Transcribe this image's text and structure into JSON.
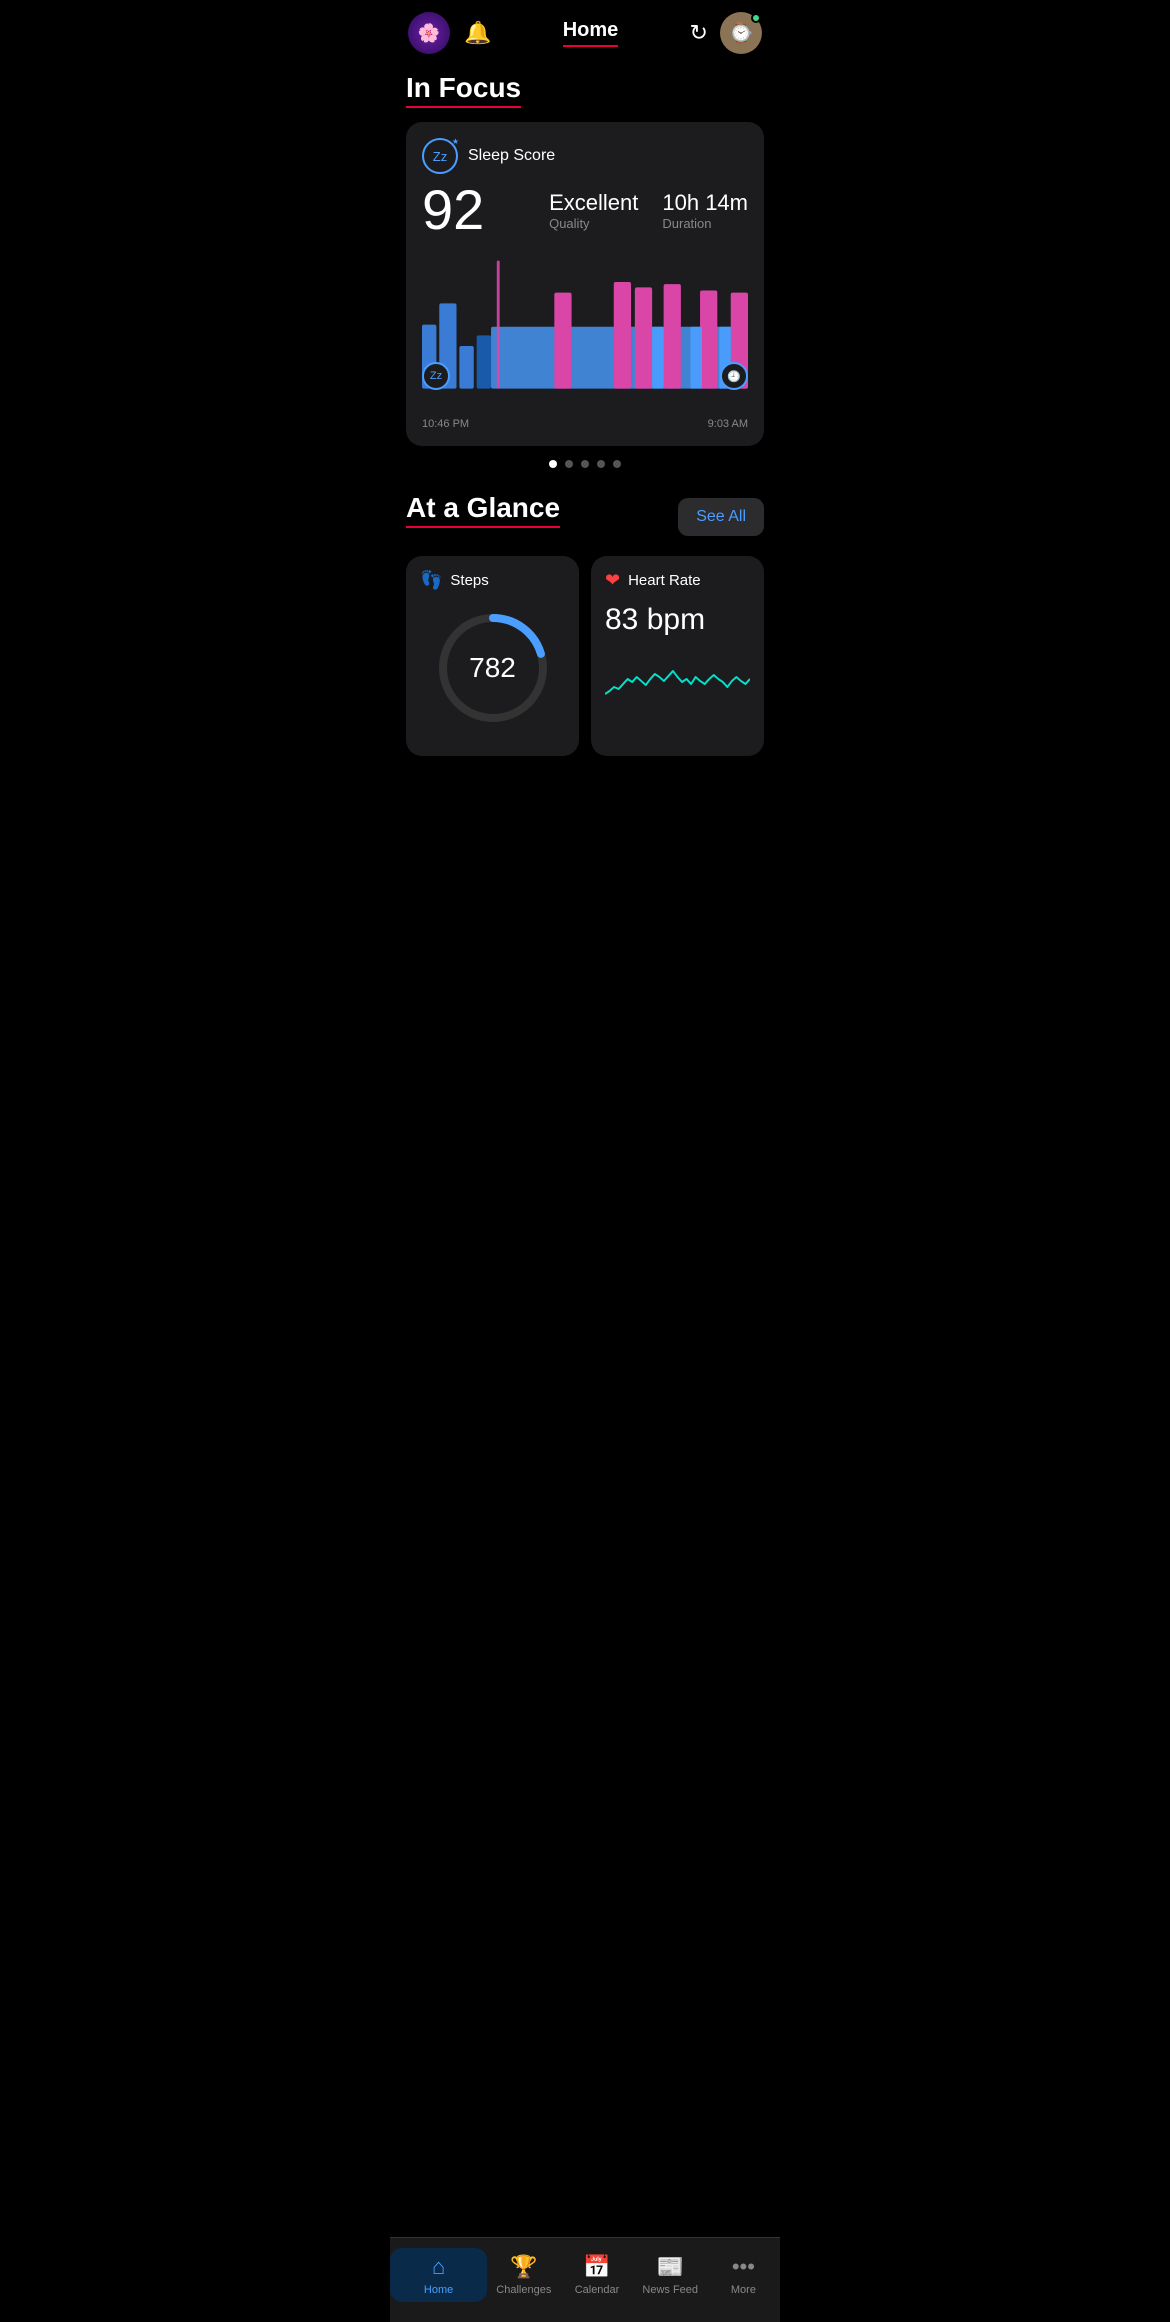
{
  "header": {
    "title": "Home",
    "bell_label": "🔔",
    "app_icon": "🌸",
    "refresh_label": "↻",
    "watch_emoji": "⌚"
  },
  "in_focus": {
    "title": "In Focus",
    "sleep_card": {
      "label": "Sleep Score",
      "score": "92",
      "quality_value": "Excellent",
      "quality_label": "Quality",
      "duration_value": "10h 14m",
      "duration_label": "Duration",
      "time_start": "10:46 PM",
      "time_end": "9:03 AM",
      "zzz_left": "Zz",
      "clock_right": "🕘"
    }
  },
  "at_a_glance": {
    "title": "At a Glance",
    "see_all": "See All",
    "steps": {
      "label": "Steps",
      "value": "782",
      "icon": "👣"
    },
    "heart_rate": {
      "label": "Heart Rate",
      "value": "83 bpm",
      "icon": "❤"
    }
  },
  "pagination": {
    "total": 5,
    "active": 0
  },
  "bottom_nav": {
    "items": [
      {
        "label": "Home",
        "icon": "⌂",
        "active": true
      },
      {
        "label": "Challenges",
        "icon": "🏆",
        "active": false
      },
      {
        "label": "Calendar",
        "icon": "📅",
        "active": false
      },
      {
        "label": "News Feed",
        "icon": "📰",
        "active": false
      },
      {
        "label": "More",
        "icon": "•••",
        "active": false
      }
    ]
  },
  "colors": {
    "blue": "#4a9eff",
    "pink": "#d946a8",
    "accent": "#e8003d"
  }
}
